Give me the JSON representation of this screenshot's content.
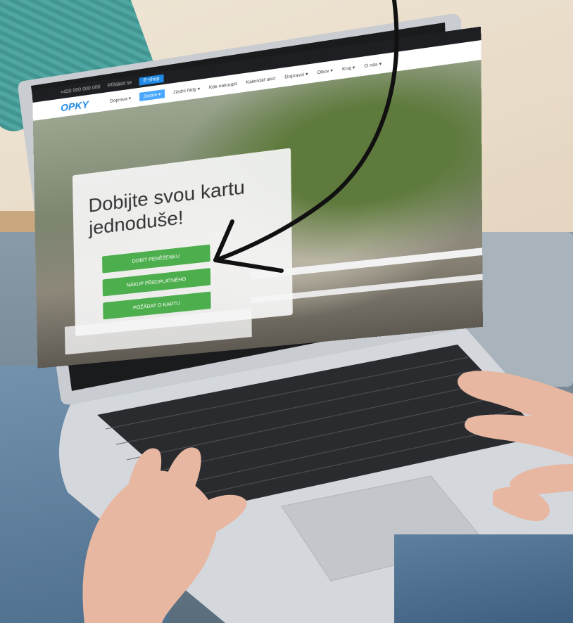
{
  "website": {
    "topbar": {
      "phone_text": "+420 000 000 000",
      "login_text": "Přihlásit se",
      "button_label": "E-shop"
    },
    "logo": "OPKY",
    "nav_items": [
      {
        "label": "Doprava ▾"
      },
      {
        "label": "Jízdné ▾",
        "active": true
      },
      {
        "label": "Jízdní řády ▾"
      },
      {
        "label": "Kde nakoupit"
      },
      {
        "label": "Kalendář akcí"
      },
      {
        "label": "Dopravci ▾"
      },
      {
        "label": "Obce ▾"
      },
      {
        "label": "Kraj ▾"
      },
      {
        "label": "O nás ▾"
      }
    ],
    "hero": {
      "heading": "Dobijte svou kartu jednoduše!",
      "buttons": [
        {
          "label": "DOBÍT PENĚŽENKU"
        },
        {
          "label": "NÁKUP PŘEDPLATNÉHO"
        },
        {
          "label": "POŽÁDAT O KARTU"
        }
      ]
    }
  },
  "colors": {
    "button_green": "#4cae4c",
    "logo_blue": "#1e88e5",
    "topbar_dark": "#1d1f22"
  }
}
